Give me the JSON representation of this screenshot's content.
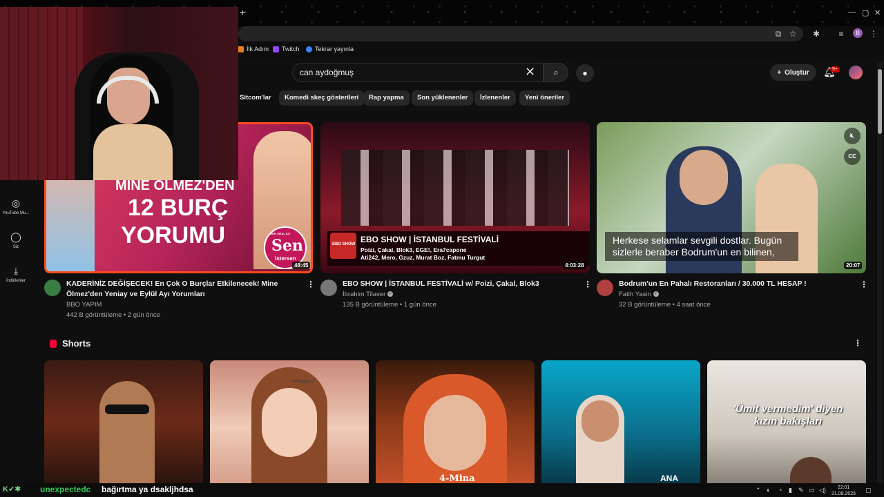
{
  "browser": {
    "bookmarks": [
      "İlk Adım",
      "Twitch",
      "Tekrar yayınla"
    ]
  },
  "youtube": {
    "search_query": "can aydoğmuş",
    "create_label": "Oluştur",
    "notif_badge": "9+",
    "chips": [
      "Sitcom'lar",
      "Komedi skeç gösterileri",
      "Rap yapma",
      "Son yüklenenler",
      "İzlenenler",
      "Yeni öneriler"
    ],
    "sidebar": [
      {
        "label": "YouTube Mu...",
        "icon": "music-icon"
      },
      {
        "label": "Siz",
        "icon": "user-icon"
      },
      {
        "label": "İndirilenler",
        "icon": "download-icon"
      }
    ],
    "videos": [
      {
        "title": "KADERİNİZ DEĞİŞECEK! En Çok O Burçlar Etkilenecek! Mine Ölmez'den Yeniay ve Eylül Ayı Yorumları",
        "channel": "BBO YAPIM",
        "meta": "442 B görüntüleme • 2 gün önce",
        "duration": "48:45",
        "thumb_text_1": "MİNE ÖLMEZ'DEN",
        "thumb_text_2": "12 BURÇ",
        "thumb_text_3": "YORUMU",
        "thumb_badge_small": "NUR VİRAL İLE",
        "thumb_badge_big": "Sen",
        "thumb_badge_sub": "istersen"
      },
      {
        "title": "EBO SHOW | İSTANBUL FESTİVALİ w/ Poizi, Çakal, Blok3",
        "channel": "İbrahim Tilaver",
        "meta": "135 B görüntüleme • 1 gün önce",
        "duration": "4:03:28",
        "thumb_logo": "EBO SHOW",
        "thumb_heading": "EBO SHOW | İSTANBUL FESTİVALİ",
        "thumb_line_1": "Poizi, Çakal, Blok3, EGE!, Era7capone",
        "thumb_line_2": "Ati242, Mero, Gzuz, Murat Boz, Fatmu Turgut"
      },
      {
        "title": "Bodrum'un En Pahalı Restoranları / 30.000 TL HESAP !",
        "channel": "Fatih Yasin",
        "meta": "32 B görüntüleme • 4 saat önce",
        "duration": "20:07",
        "caption": "Herkese selamlar sevgili dostlar. Bugün sizlerle beraber Bodrum'un en bilinen,"
      }
    ],
    "shorts_title": "Shorts",
    "shorts": [
      {
        "overlay": ""
      },
      {
        "overlay": "bulltagency"
      },
      {
        "overlay": "4-Mina"
      },
      {
        "overlay": "ANA"
      },
      {
        "overlay": "'Ümit vermedim' diyen kızın bakışları"
      }
    ]
  },
  "stream_chat": {
    "username": "unexpectedc",
    "message": "bağırtma ya dsakljhdsa"
  },
  "taskbar": {
    "time": "22:01",
    "date": "21.08.2025"
  },
  "colors": {
    "background": "#0f0f0f",
    "accent_red": "#ff0033",
    "chat_user": "#34c759"
  }
}
